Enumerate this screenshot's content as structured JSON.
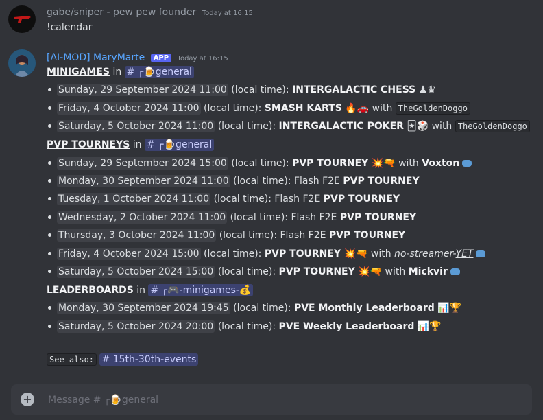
{
  "message1": {
    "username": "gabe/sniper - pew pew founder",
    "timestamp": "Today at 16:15",
    "text": "!calendar",
    "avatar_icon": "red-gun-icon"
  },
  "message2": {
    "username": "[AI-MOD] MaryMarte",
    "badge": "APP",
    "timestamp": "Today at 16:15",
    "avatar_icon": "character-avatar-icon",
    "in": "in",
    "sections": {
      "minigames": {
        "title": "MINIGAMES",
        "channel": "# ┌🍺general",
        "items": [
          {
            "date": "Sunday, 29 September 2024 11:00",
            "local": " (local time): ",
            "event": "INTERGALACTIC CHESS",
            "emoji": "♟♛"
          },
          {
            "date": "Friday, 4 October 2024 11:00",
            "local": " (local time): ",
            "event": "SMASH KARTS",
            "emoji": "🔥🚗",
            "with": " with ",
            "host": "TheGoldenDoggo"
          },
          {
            "date": "Saturday, 5 October 2024 11:00",
            "local": " (local time): ",
            "event": "INTERGALACTIC POKER",
            "emoji": "🃏🎲",
            "with": " with ",
            "host": "TheGoldenDoggo"
          }
        ]
      },
      "pvp": {
        "title": "PVP TOURNEYS",
        "channel": "# ┌🍺general",
        "items": [
          {
            "date": "Sunday, 29 September 2024 15:00",
            "local": " (local time): ",
            "event": "PVP TOURNEY",
            "emoji": "💥🔫",
            "with": " with ",
            "host": "Voxton"
          },
          {
            "date": "Monday, 30 September 2024 11:00",
            "local": " (local time): Flash F2E ",
            "event": "PVP TOURNEY"
          },
          {
            "date": "Tuesday, 1 October 2024 11:00",
            "local": " (local time): Flash F2E ",
            "event": "PVP TOURNEY"
          },
          {
            "date": "Wednesday, 2 October 2024 11:00",
            "local": " (local time): Flash F2E ",
            "event": "PVP TOURNEY"
          },
          {
            "date": "Thursday, 3 October 2024 11:00",
            "local": " (local time): Flash F2E ",
            "event": "PVP TOURNEY"
          },
          {
            "date": "Friday, 4 October 2024 15:00",
            "local": " (local time): ",
            "event": "PVP TOURNEY",
            "emoji": "💥🔫",
            "with": " with ",
            "host_pre": "no-streamer-",
            "host_post": "YET"
          },
          {
            "date": "Saturday, 5 October 2024 15:00",
            "local": " (local time): ",
            "event": "PVP TOURNEY",
            "emoji": "💥🔫",
            "with": " with ",
            "host": "Mickvir"
          }
        ]
      },
      "leaderboards": {
        "title": "LEADERBOARDS",
        "channel": "# ┌🎮-minigames-💰",
        "items": [
          {
            "date": "Monday, 30 September 2024 19:45",
            "local": " (local time): ",
            "event": "PVE Monthly Leaderboard",
            "emoji": "📊🏆"
          },
          {
            "date": "Saturday, 5 October 2024 20:00",
            "local": " (local time): ",
            "event": "PVE Weekly Leaderboard",
            "emoji": "📊🏆"
          }
        ]
      }
    },
    "see_also_label": "See also:",
    "see_also_channel": "# 15th-30th-events"
  },
  "input": {
    "plus_icon": "add-attachment-icon",
    "placeholder": "Message # ┌🍺general"
  },
  "colors": {
    "background": "#313338",
    "username1": "#949ba4",
    "username2": "#58a6ff",
    "app_badge": "#5865f2",
    "channel_mention_bg": "#3c4270"
  }
}
